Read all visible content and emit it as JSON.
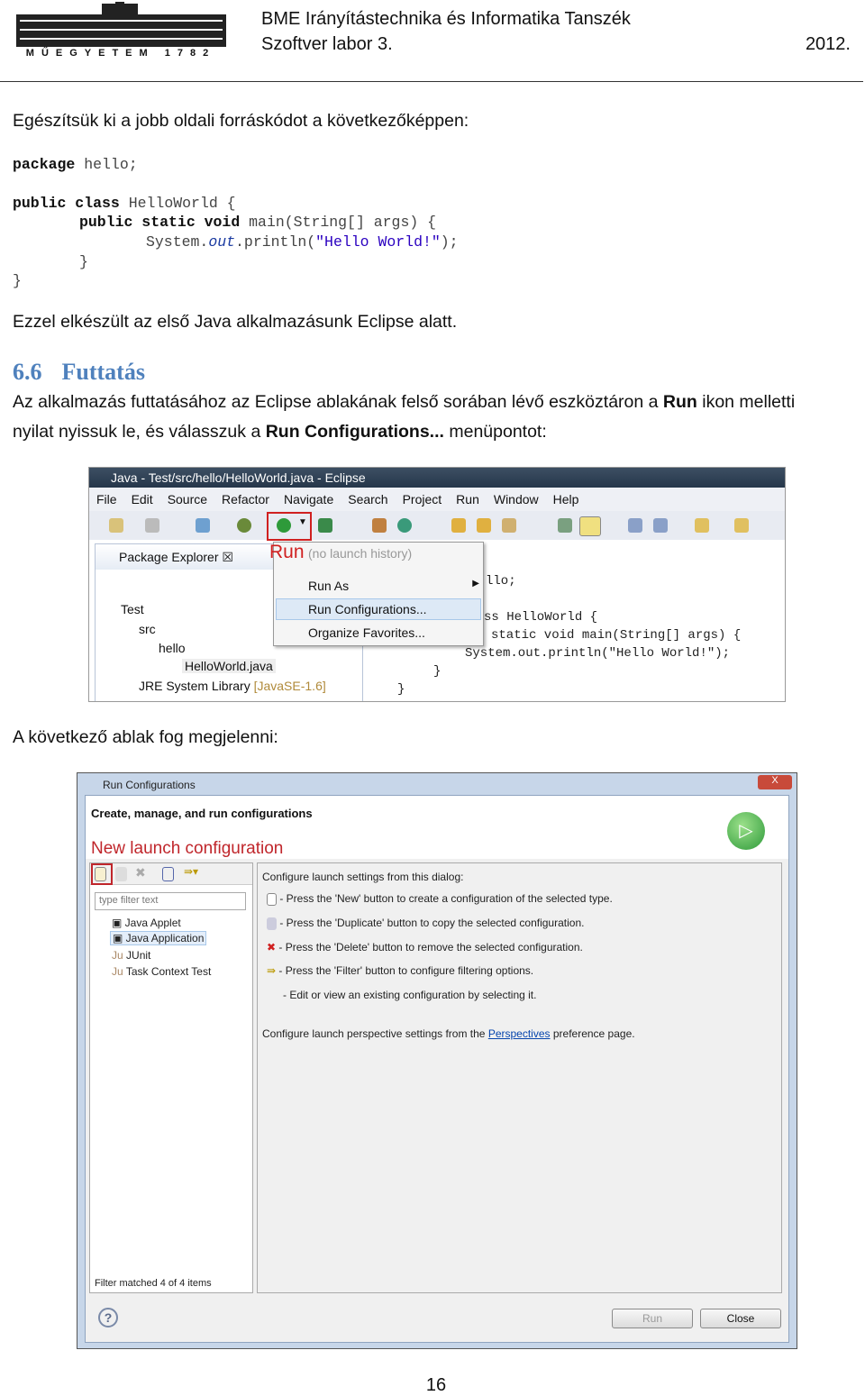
{
  "header": {
    "logo_text": "MŰEGYETEM 1782",
    "department": "BME Irányítástechnika és Informatika Tanszék",
    "course": "Szoftver labor 3.",
    "year": "2012."
  },
  "intro": "Egészítsük ki a jobb oldali forráskódot a következőképpen:",
  "code": {
    "l1_kw": "package",
    "l1_rest": " hello;",
    "l2_kw": "public class",
    "l2_rest": " HelloWorld {",
    "l3_kw": "public static void",
    "l3_rest": " main(String[] args) {",
    "l4_a": "System.",
    "l4_out": "out",
    "l4_b": ".println(",
    "l4_str": "\"Hello World!\"",
    "l4_c": ");",
    "l5": "}",
    "l6": "}"
  },
  "after_code": "Ezzel elkészült az első Java alkalmazásunk Eclipse alatt.",
  "section": {
    "number": "6.6",
    "title": "Futtatás"
  },
  "para": {
    "a": "Az alkalmazás futtatásához az Eclipse ablakának felső sorában lévő eszköztáron a ",
    "run": "Run",
    "b": " ikon melletti",
    "c": "nyilat nyissuk le, és válasszuk a ",
    "runconf": "Run Configurations...",
    "d": " menüpontot:"
  },
  "eclipse": {
    "title": "Java - Test/src/hello/HelloWorld.java - Eclipse",
    "menu": [
      "File",
      "Edit",
      "Source",
      "Refactor",
      "Navigate",
      "Search",
      "Project",
      "Run",
      "Window",
      "Help"
    ],
    "run_label": "Run",
    "dropdown": {
      "history": "(no launch history)",
      "items": [
        "Run As",
        "Run Configurations...",
        "Organize Favorites..."
      ]
    },
    "package_explorer": "Package Explorer",
    "tree": [
      "Test",
      "src",
      "hello",
      "HelloWorld.java",
      "JRE System Library"
    ],
    "jre_version": "[JavaSE-1.6]",
    "code": [
      "llo;",
      "ss HelloWorld {",
      "static void main(String[] args) {",
      "System.out.println(\"Hello World!\");",
      "}",
      "}"
    ]
  },
  "next_text": "A következő ablak fog megjelenni:",
  "dialog": {
    "title": "Run Configurations",
    "subtitle": "Create, manage, and run configurations",
    "annotation": "New launch configuration",
    "filter_placeholder": "type filter text",
    "types": [
      "Java Applet",
      "Java Application",
      "JUnit",
      "Task Context Test"
    ],
    "filter_status": "Filter matched 4 of 4 items",
    "info_title": "Configure launch settings from this dialog:",
    "info_lines": [
      "- Press the 'New' button to create a configuration of the selected type.",
      "- Press the 'Duplicate' button to copy the selected configuration.",
      "- Press the 'Delete' button to remove the selected configuration.",
      "- Press the 'Filter' button to configure filtering options.",
      "- Edit or view an existing configuration by selecting it."
    ],
    "persp_a": "Configure launch perspective settings from the ",
    "persp_link": "Perspectives",
    "persp_b": " preference page.",
    "run_button": "Run",
    "close_button": "Close",
    "close_x": "X",
    "help": "?"
  },
  "page_number": "16",
  "colors": {
    "heading": "#4f81bd",
    "annotation": "#c0262b",
    "link": "#0645ad"
  }
}
